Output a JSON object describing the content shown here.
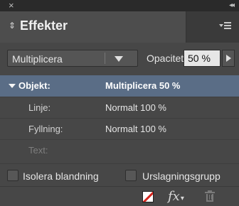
{
  "window": {
    "close_glyph": "×",
    "collapse_glyph": "◂◂"
  },
  "panel": {
    "tab_arrows_glyph": "⇕",
    "title": "Effekter",
    "menu_icon": "panel-menu-icon"
  },
  "controls": {
    "blend_mode": "Multiplicera",
    "opacity_label": "Opacitet:",
    "opacity_value": "50 %"
  },
  "list": {
    "header": {
      "label": "Objekt:",
      "value": "Multiplicera 50 %"
    },
    "rows": [
      {
        "label": "Linje:",
        "value": "Normalt 100 %"
      },
      {
        "label": "Fyllning:",
        "value": "Normalt 100 %"
      },
      {
        "label": "Text:",
        "value": ""
      }
    ]
  },
  "options": {
    "isolate_label": "Isolera blandning",
    "knockout_label": "Urslagningsgrupp",
    "isolate_checked": false,
    "knockout_checked": false
  },
  "footer": {
    "fx_label": "fx",
    "fx_caret": "▾",
    "icons": [
      "clear-effects-icon",
      "fx-icon",
      "trash-icon"
    ]
  },
  "colors": {
    "panel_bg": "#474747",
    "titlebar_bg": "#2a2a2a",
    "selected_row": "#5a6d86",
    "text": "#dcdcdc"
  }
}
